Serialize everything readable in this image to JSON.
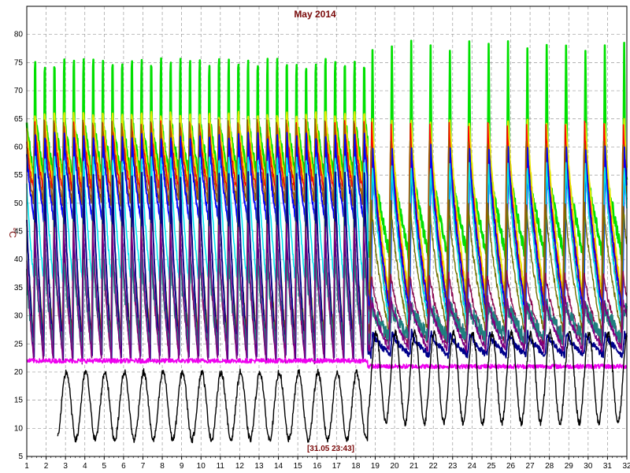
{
  "chart_data": {
    "type": "line",
    "title": "May 2014",
    "ylabel": "°C",
    "xlabel": "",
    "cursor_label": "[31.05 23:43]",
    "xlim": [
      1,
      32
    ],
    "ylim": [
      5,
      85
    ],
    "x_ticks": [
      1,
      2,
      3,
      4,
      5,
      6,
      7,
      8,
      9,
      10,
      11,
      12,
      13,
      14,
      15,
      16,
      17,
      18,
      19,
      20,
      21,
      22,
      23,
      24,
      25,
      26,
      27,
      28,
      29,
      30,
      31,
      32
    ],
    "y_ticks": [
      5,
      10,
      15,
      20,
      25,
      30,
      35,
      40,
      45,
      50,
      55,
      60,
      65,
      70,
      75,
      80
    ],
    "grid": true,
    "legend": "none",
    "series": [
      {
        "color": "#00e000",
        "width": 2.6,
        "base": 54,
        "peak": 80,
        "pattern": "spiky",
        "min2": 40,
        "peak2": 78
      },
      {
        "color": "#e8e800",
        "width": 2.0,
        "base": 53,
        "peak": 67,
        "pattern": "sawtooth",
        "min2": 33,
        "peak2": 66
      },
      {
        "color": "#ff0000",
        "width": 1.6,
        "base": 52,
        "peak": 65,
        "pattern": "sawtooth",
        "min2": 32,
        "peak2": 64
      },
      {
        "color": "#a05a00",
        "width": 1.6,
        "base": 50,
        "peak": 65,
        "pattern": "sawtooth",
        "min2": 30,
        "peak2": 62
      },
      {
        "color": "#0000ff",
        "width": 1.8,
        "base": 47,
        "peak": 62,
        "pattern": "sawtooth",
        "min2": 30,
        "peak2": 60
      },
      {
        "color": "#00e5ee",
        "width": 1.6,
        "base": 36,
        "peak": 60,
        "pattern": "sawtooth",
        "min2": 28,
        "peak2": 58
      },
      {
        "color": "#707000",
        "width": 1.4,
        "base": 26,
        "peak": 55,
        "pattern": "sawtooth",
        "min2": 27,
        "peak2": 50
      },
      {
        "color": "#8b0a50",
        "width": 1.4,
        "base": 23,
        "peak": 45,
        "pattern": "sawtooth",
        "min2": 25,
        "peak2": 38
      },
      {
        "color": "#00008b",
        "width": 1.8,
        "base": 22,
        "peak": 55,
        "pattern": "sawtooth",
        "min2": 23,
        "peak2": 27
      },
      {
        "color": "#1f7f7f",
        "width": 1.8,
        "base": 24,
        "peak": 42,
        "pattern": "noisy",
        "min2": 26,
        "peak2": 32
      },
      {
        "color": "#800080",
        "width": 1.4,
        "base": 22,
        "peak": 48,
        "pattern": "sawtooth",
        "min2": 24,
        "peak2": 33
      },
      {
        "color": "#ee00ee",
        "width": 1.6,
        "base": 22,
        "peak": 22,
        "pattern": "flat",
        "min2": 21,
        "peak2": 22.5
      },
      {
        "color": "#000000",
        "width": 1.4,
        "base": 8,
        "peak": 20,
        "pattern": "outdoor",
        "min2": 11,
        "peak2": 27
      }
    ]
  }
}
